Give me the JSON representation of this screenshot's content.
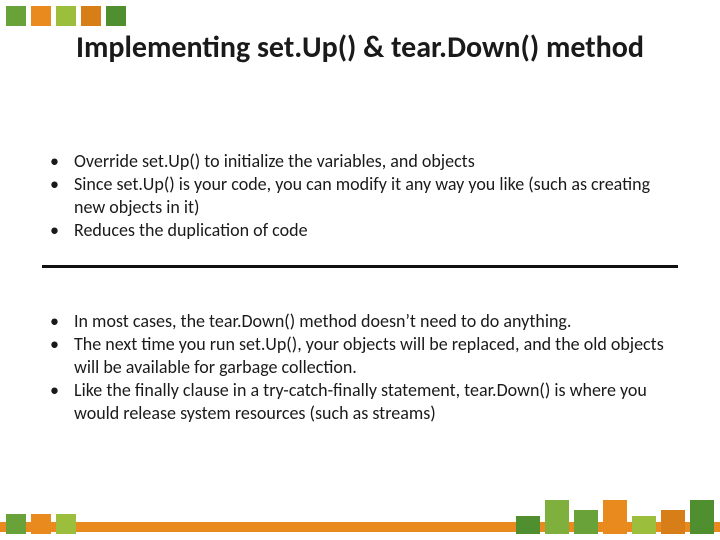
{
  "colors": {
    "accent_orange": "#e88a1e",
    "accent_green": "#6aa23a"
  },
  "title": "Implementing  set.Up() & tear.Down() method",
  "block1": {
    "items": [
      "Override set.Up() to initialize the variables, and objects",
      "Since set.Up() is your code, you can modify it any way you like (such as creating new objects in it)",
      "Reduces the duplication of code"
    ]
  },
  "block2": {
    "items": [
      "In most cases, the tear.Down() method doesn’t need to do anything.",
      "The next time you run set.Up(), your objects will be replaced, and the old objects will be available for garbage collection.",
      "Like the finally clause in a try-catch-finally statement, tear.Down() is where you would release system resources (such as streams)"
    ]
  }
}
